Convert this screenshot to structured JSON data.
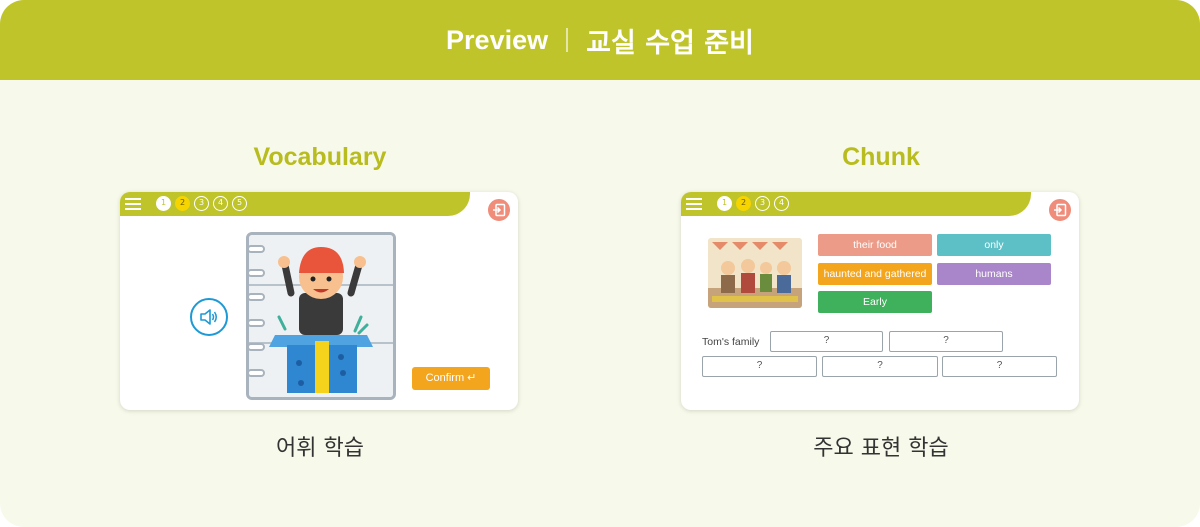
{
  "header": {
    "title": "Preview",
    "subtitle": "교실 수업 준비"
  },
  "vocabulary": {
    "title": "Vocabulary",
    "caption": "어휘 학습",
    "steps": [
      "1",
      "2",
      "3",
      "4",
      "5"
    ],
    "current_step": 2,
    "confirm_label": "Confirm ↵"
  },
  "chunk": {
    "title": "Chunk",
    "caption": "주요 표현 학습",
    "steps": [
      "1",
      "2",
      "3",
      "4"
    ],
    "current_step": 2,
    "chips": [
      "their food",
      "only",
      "haunted and gathered",
      "humans",
      "Early"
    ],
    "family_label": "Tom's family",
    "blanks": [
      "?",
      "?",
      "?",
      "?",
      "?"
    ]
  },
  "colors": {
    "accent": "#bfc42a",
    "background": "#f7f9ea",
    "exit": "#ef8c7a",
    "confirm": "#f2a51d"
  }
}
